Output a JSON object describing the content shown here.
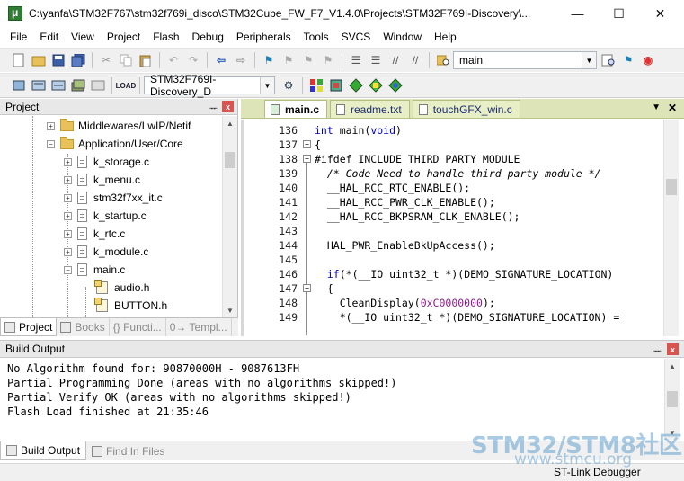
{
  "window": {
    "title": "C:\\yanfa\\STM32F767\\stm32f769i_disco\\STM32Cube_FW_F7_V1.4.0\\Projects\\STM32F769I-Discovery\\...",
    "minimize_glyph": "—",
    "maximize_glyph": "☐",
    "close_glyph": "✕"
  },
  "menu": [
    "File",
    "Edit",
    "View",
    "Project",
    "Flash",
    "Debug",
    "Peripherals",
    "Tools",
    "SVCS",
    "Window",
    "Help"
  ],
  "toolbar": {
    "find_combo_value": "main",
    "target_combo_value": "STM32F769I-Discovery_D"
  },
  "project_panel": {
    "title": "Project",
    "pin_glyph": "ᅲ",
    "close_glyph": "x",
    "tree": [
      {
        "label": "Middlewares/LwIP/Netif",
        "type": "folder",
        "expander": "+"
      },
      {
        "label": "Application/User/Core",
        "type": "folder",
        "expander": "−"
      },
      {
        "label": "k_storage.c",
        "type": "file",
        "expander": "+"
      },
      {
        "label": "k_menu.c",
        "type": "file",
        "expander": "+"
      },
      {
        "label": "stm32f7xx_it.c",
        "type": "file",
        "expander": "+"
      },
      {
        "label": "k_startup.c",
        "type": "file",
        "expander": "+"
      },
      {
        "label": "k_rtc.c",
        "type": "file",
        "expander": "+"
      },
      {
        "label": "k_module.c",
        "type": "file",
        "expander": "+"
      },
      {
        "label": "main.c",
        "type": "file",
        "expander": "−"
      },
      {
        "label": "audio.h",
        "type": "header",
        "expander": ""
      },
      {
        "label": "BUTTON.h",
        "type": "header",
        "expander": ""
      }
    ],
    "tabs": [
      {
        "label": "Project",
        "active": true
      },
      {
        "label": "Books",
        "active": false
      },
      {
        "label": "{} Functi...",
        "active": false
      },
      {
        "label": "0→ Templ...",
        "active": false
      }
    ]
  },
  "editor": {
    "tabs": [
      {
        "label": "main.c",
        "active": true
      },
      {
        "label": "readme.txt",
        "active": false
      },
      {
        "label": "touchGFX_win.c",
        "active": false
      }
    ],
    "lines": [
      {
        "num": "136",
        "fold": "",
        "text": "int main(void)"
      },
      {
        "num": "137",
        "fold": "−",
        "text": "{"
      },
      {
        "num": "138",
        "fold": "−",
        "text": "#ifdef INCLUDE_THIRD_PARTY_MODULE"
      },
      {
        "num": "139",
        "fold": "",
        "text": "  /* Code Need to handle third party module */"
      },
      {
        "num": "140",
        "fold": "",
        "text": "  __HAL_RCC_RTC_ENABLE();"
      },
      {
        "num": "141",
        "fold": "",
        "text": "  __HAL_RCC_PWR_CLK_ENABLE();"
      },
      {
        "num": "142",
        "fold": "",
        "text": "  __HAL_RCC_BKPSRAM_CLK_ENABLE();"
      },
      {
        "num": "143",
        "fold": "",
        "text": ""
      },
      {
        "num": "144",
        "fold": "",
        "text": "  HAL_PWR_EnableBkUpAccess();"
      },
      {
        "num": "145",
        "fold": "",
        "text": ""
      },
      {
        "num": "146",
        "fold": "",
        "text": "  if(*(__IO uint32_t *)(DEMO_SIGNATURE_LOCATION)"
      },
      {
        "num": "147",
        "fold": "−",
        "text": "  {"
      },
      {
        "num": "148",
        "fold": "",
        "text": "    CleanDisplay(0xC0000000);"
      },
      {
        "num": "149",
        "fold": "",
        "text": "    *(__IO uint32_t *)(DEMO_SIGNATURE_LOCATION) ="
      }
    ]
  },
  "build_output": {
    "title": "Build Output",
    "lines": [
      "No Algorithm found for: 90870000H - 9087613FH",
      "Partial Programming Done (areas with no algorithms skipped!)",
      "Partial Verify OK (areas with no algorithms skipped!)",
      "Flash Load finished at 21:35:46"
    ],
    "tabs": [
      {
        "label": "Build Output",
        "active": true
      },
      {
        "label": "Find In Files",
        "active": false
      }
    ]
  },
  "status_bar": {
    "debugger": "ST-Link Debugger"
  },
  "watermark": {
    "line1": "STM32/STM8社区",
    "line2": "www.stmcu.org"
  },
  "colors": {
    "editor_tab_strip": "#dde5b8",
    "keyword": "#0000c8",
    "comment": "#008000",
    "preprocessor": "#8b1a8b"
  }
}
